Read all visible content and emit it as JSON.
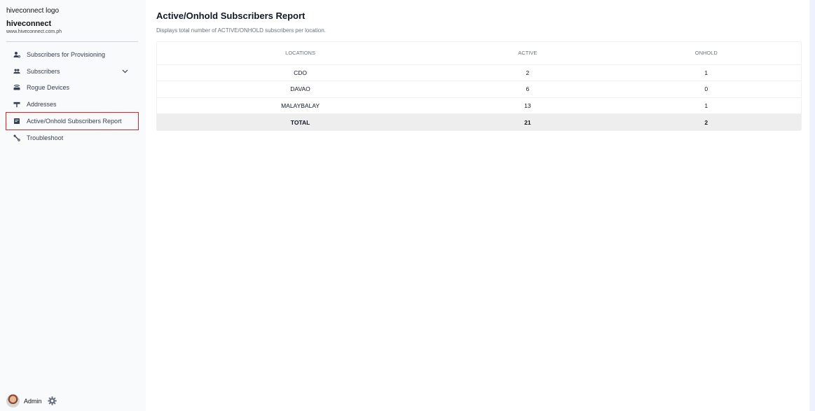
{
  "sidebar": {
    "logo_alt": "hiveconnect logo",
    "brand_name": "hiveconnect",
    "brand_url": "www.hiveconnect.com.ph",
    "items": [
      {
        "label": "Subscribers for Provisioning",
        "icon": "person-gear-icon"
      },
      {
        "label": "Subscribers",
        "icon": "people-icon"
      },
      {
        "label": "Rogue Devices",
        "icon": "router-icon"
      },
      {
        "label": "Addresses",
        "icon": "signpost-icon"
      },
      {
        "label": "Active/Onhold Subscribers Report",
        "icon": "report-icon"
      },
      {
        "label": "Troubleshoot",
        "icon": "wrench-icon"
      }
    ],
    "user": {
      "name": "Admin"
    }
  },
  "main": {
    "title": "Active/Onhold Subscribers Report",
    "description": "Displays total number of ACTIVE/ONHOLD subscribers per location."
  },
  "table": {
    "headers": [
      "LOCATIONS",
      "ACTIVE",
      "ONHOLD"
    ],
    "rows": [
      [
        "CDO",
        "2",
        "1"
      ],
      [
        "DAVAO",
        "6",
        "0"
      ],
      [
        "MALAYBALAY",
        "13",
        "1"
      ]
    ],
    "total": [
      "TOTAL",
      "21",
      "2"
    ]
  },
  "colors": {
    "highlight": "#dc2626",
    "total_row_bg": "#eeeeee"
  }
}
